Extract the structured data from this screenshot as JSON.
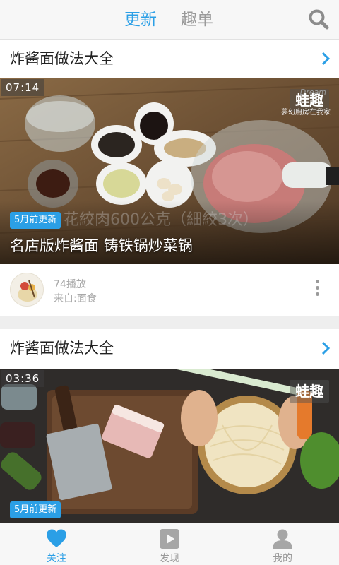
{
  "top_tabs": {
    "active": "更新",
    "inactive": "趣单"
  },
  "colors": {
    "accent": "#2b9fe6",
    "muted": "#9a9a9a"
  },
  "feed": [
    {
      "section_title": "炸酱面做法大全",
      "duration": "07:14",
      "watermark": "蛙趣",
      "watermark_sub": "夢幻廚房在我家",
      "watermark_top": "Dream",
      "update_badge": "5月前更新",
      "video_title": "名店版炸酱面 铸铁锅炒菜锅",
      "plays": "74播放",
      "source": "来自:面食"
    },
    {
      "section_title": "炸酱面做法大全",
      "duration": "03:36",
      "watermark": "蛙趣",
      "update_badge": "5月前更新"
    }
  ],
  "bottom_nav": [
    {
      "label": "关注",
      "icon": "heart-icon",
      "active": true
    },
    {
      "label": "发现",
      "icon": "play-icon",
      "active": false
    },
    {
      "label": "我的",
      "icon": "person-icon",
      "active": false
    }
  ]
}
